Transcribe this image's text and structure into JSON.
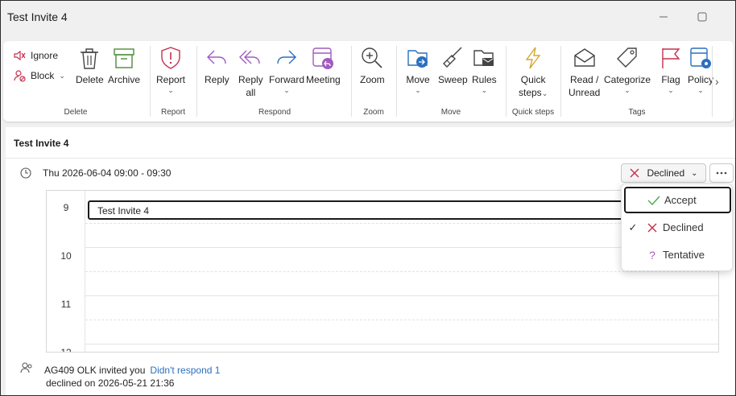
{
  "window": {
    "title": "Test Invite 4"
  },
  "ribbon": {
    "delete_group": {
      "label": "Delete",
      "ignore": "Ignore",
      "block": "Block",
      "delete": "Delete",
      "archive": "Archive"
    },
    "report_group": {
      "label": "Report",
      "report": "Report"
    },
    "respond_group": {
      "label": "Respond",
      "reply": "Reply",
      "reply_all_1": "Reply",
      "reply_all_2": "all",
      "forward": "Forward",
      "meeting": "Meeting"
    },
    "zoom_group": {
      "label": "Zoom",
      "zoom": "Zoom"
    },
    "move_group": {
      "label": "Move",
      "move": "Move",
      "sweep": "Sweep",
      "rules": "Rules"
    },
    "quicksteps_group": {
      "label": "Quick steps",
      "quick_1": "Quick",
      "quick_2": "steps"
    },
    "tags_group": {
      "label": "Tags",
      "read_1": "Read /",
      "read_2": "Unread",
      "categorize": "Categorize",
      "flag": "Flag",
      "policy": "Policy"
    }
  },
  "message": {
    "subject": "Test Invite 4",
    "time": "Thu 2026-06-04 09:00 - 09:30",
    "response_button": "Declined",
    "calendar": {
      "hours": [
        "9",
        "10",
        "11",
        "12"
      ],
      "event_title": "Test Invite 4"
    },
    "dropdown": {
      "items": [
        {
          "label": "Accept",
          "icon": "check-icon",
          "color": "#4ca64c"
        },
        {
          "label": "Declined",
          "icon": "x-icon",
          "color": "#c4314b",
          "selected_mark": "✓"
        },
        {
          "label": "Tentative",
          "icon": "question-icon",
          "color": "#a05bbf"
        }
      ]
    },
    "footer": {
      "inviter": "AG409 OLK invited you",
      "no_response": "Didn't respond 1",
      "declined_on": "declined on 2026-05-21 21:36"
    }
  }
}
